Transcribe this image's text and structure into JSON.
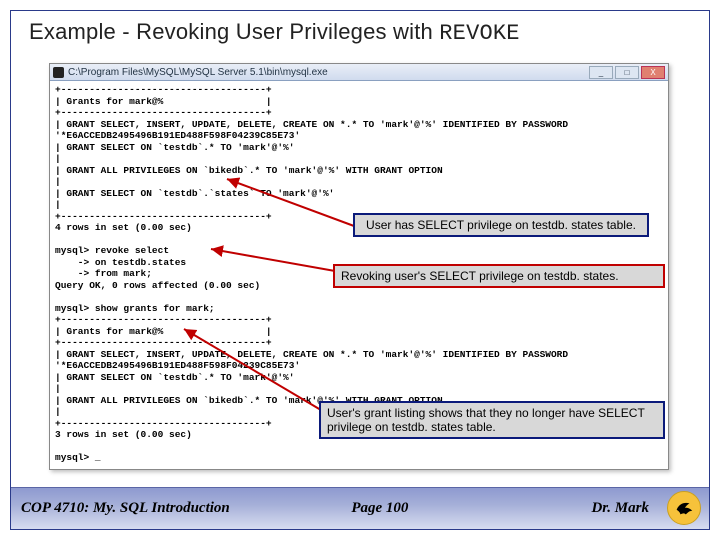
{
  "slide": {
    "title_text": "Example - Revoking User Privileges with ",
    "title_code": "REVOKE"
  },
  "window": {
    "title": "C:\\Program Files\\MySQL\\MySQL Server 5.1\\bin\\mysql.exe",
    "min_label": "_",
    "max_label": "□",
    "close_label": "X"
  },
  "terminal_lines": [
    "+------------------------------------+",
    "| Grants for mark@%                  |",
    "+------------------------------------+",
    "| GRANT SELECT, INSERT, UPDATE, DELETE, CREATE ON *.* TO 'mark'@'%' IDENTIFIED BY PASSWORD",
    "'*E6ACCEDB2495496B191ED488F598F04239C85E73'",
    "| GRANT SELECT ON `testdb`.* TO 'mark'@'%'",
    "|",
    "| GRANT ALL PRIVILEGES ON `bikedb`.* TO 'mark'@'%' WITH GRANT OPTION",
    "|",
    "| GRANT SELECT ON `testdb`.`states` TO 'mark'@'%'",
    "|",
    "+------------------------------------+",
    "4 rows in set (0.00 sec)",
    "",
    "mysql> revoke select",
    "    -> on testdb.states",
    "    -> from mark;",
    "Query OK, 0 rows affected (0.00 sec)",
    "",
    "mysql> show grants for mark;",
    "+------------------------------------+",
    "| Grants for mark@%                  |",
    "+------------------------------------+",
    "| GRANT SELECT, INSERT, UPDATE, DELETE, CREATE ON *.* TO 'mark'@'%' IDENTIFIED BY PASSWORD",
    "'*E6ACCEDB2495496B191ED488F598F04239C85E73'",
    "| GRANT SELECT ON `testdb`.* TO 'mark'@'%'",
    "|",
    "| GRANT ALL PRIVILEGES ON `bikedb`.* TO 'mark'@'%' WITH GRANT OPTION",
    "|",
    "+------------------------------------+",
    "3 rows in set (0.00 sec)",
    "",
    "mysql> _"
  ],
  "callouts": {
    "c1": "User has SELECT privilege on testdb. states table.",
    "c2": "Revoking user's SELECT privilege on testdb. states.",
    "c3": "User's grant listing shows that they no longer have SELECT privilege on testdb. states table."
  },
  "footer": {
    "course": "COP 4710: My. SQL Introduction",
    "page": "Page 100",
    "author": "Dr. Mark"
  }
}
